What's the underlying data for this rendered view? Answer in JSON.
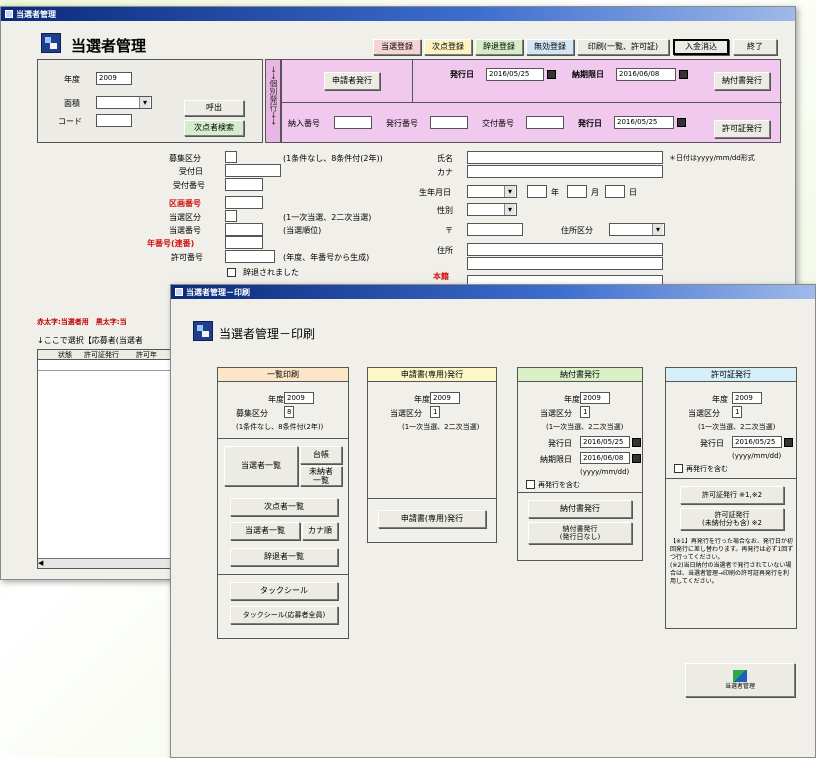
{
  "back_window": {
    "title": "当選者管理",
    "heading": "当選者管理",
    "toolbar": [
      "当選登録",
      "次点登録",
      "辞退登録",
      "無効登録",
      "印刷(一覧、許可証)",
      "入金消込",
      "終了"
    ],
    "filter": {
      "year_label": "年度",
      "year_value": "2009",
      "area_label": "面積",
      "area_value": "",
      "code_label": "コード",
      "code_value": "",
      "call_button": "呼出",
      "search_button": "次点者検索"
    },
    "vertical_label": "→→個別発行→→",
    "issue": {
      "applicant_issue_button": "申請者発行",
      "issue_date_label": "発行日",
      "issue_date_value": "2016/05/25",
      "due_date_label": "納期限日",
      "due_date_value": "2016/06/08",
      "payment_slip_button": "納付書発行",
      "payment_no_label": "納入番号",
      "issue_no_label": "発行番号",
      "delivery_no_label": "交付番号",
      "issue_date2_label": "発行日",
      "issue_date2_value": "2016/05/25",
      "permit_button": "許可証発行"
    },
    "form": {
      "category_label": "募集区分",
      "category_hint": "(1条件なし、8条件付(2年))",
      "recv_date_label": "受付日",
      "recv_no_label": "受付番号",
      "lot_no_label": "区画番号",
      "win_type_label": "当選区分",
      "win_type_hint": "(1一次当選、2二次当選)",
      "win_no_label": "当選番号",
      "win_no_hint": "(当選順位)",
      "year_no_label": "年番号(連番)",
      "permit_no_label": "許可番号",
      "permit_no_hint": "(年度、年番号から生成)",
      "withdrawn_label": "辞退されました",
      "name_label": "氏名",
      "kana_label": "カナ",
      "date_note": "＊日付はyyyy/mm/dd形式",
      "birth_label": "生年月日",
      "year_unit": "年",
      "month_unit": "月",
      "day_unit": "日",
      "sex_label": "性別",
      "zip_label": "〒",
      "addr_type_label": "住所区分",
      "address_label": "住所",
      "honseki_label": "本籍"
    },
    "legend_note": "赤太字:当選者用　黒太字:当",
    "list_hint": "↓ここで選択【応募者(当選者",
    "list_headers": [
      "状態",
      "許可証発行",
      "許可年"
    ]
  },
  "front_window": {
    "title": "当選者管理－印刷",
    "heading": "当選者管理－印刷",
    "colors": {
      "panel1": "#fbe6c7",
      "panel2": "#fbf7c7",
      "panel3": "#d9f0c7",
      "panel4": "#d6eef8"
    },
    "panel1": {
      "title": "一覧印刷",
      "year_label": "年度",
      "year_value": "2009",
      "cat_label": "募集区分",
      "cat_value": "8",
      "cat_hint": "(1条件なし、8条件付(2年))",
      "list_button": "当選者一覧",
      "ledger_button": "台帳",
      "unpaid_button": "未納者\n一覧",
      "runner_up_button": "次点者一覧",
      "winners_button": "当選者一覧",
      "kana_button": "カナ順",
      "withdrawn_button": "辞退者一覧",
      "tack_button": "タックシール",
      "tack_applicant_button": "タックシール(応募者全員)"
    },
    "panel2": {
      "title": "申請書(専用)発行",
      "year_label": "年度",
      "year_value": "2009",
      "win_label": "当選区分",
      "win_value": "1",
      "win_hint": "(1一次当選、2二次当選)",
      "issue_button": "申請書(専用)発行"
    },
    "panel3": {
      "title": "納付書発行",
      "year_label": "年度",
      "year_value": "2009",
      "win_label": "当選区分",
      "win_value": "1",
      "win_hint": "(1一次当選、2二次当選)",
      "issue_label": "発行日",
      "issue_value": "2016/05/25",
      "due_label": "納期限日",
      "due_value": "2016/06/08",
      "fmt_hint": "(yyyy/mm/dd)",
      "reissue_label": "再発行を含む",
      "issue_button": "納付書発行",
      "issue_nodate_button": "納付書発行\n(発行日なし)"
    },
    "panel4": {
      "title": "許可証発行",
      "year_label": "年度",
      "year_value": "2009",
      "win_label": "当選区分",
      "win_value": "1",
      "win_hint": "(1一次当選、2二次当選)",
      "issue_label": "発行日",
      "issue_value": "2016/05/25",
      "fmt_hint": "(yyyy/mm/dd)",
      "reissue_label": "再発行を含む",
      "permit_button": "許可証発行 ※1,※2",
      "permit_unpaid_button": "許可証発行\n(未納付分も含) ※2",
      "note": "【※1】再発行を行った場合なお、発行日が初回発行に差し替わります。再発行は必ず1回ずつ行ってください。\n(※2)当日納付の当選者で発行されていない場合は、当選者管理→印刷の許可証再発行を利用してください。"
    },
    "back_button": "当選者管理"
  }
}
